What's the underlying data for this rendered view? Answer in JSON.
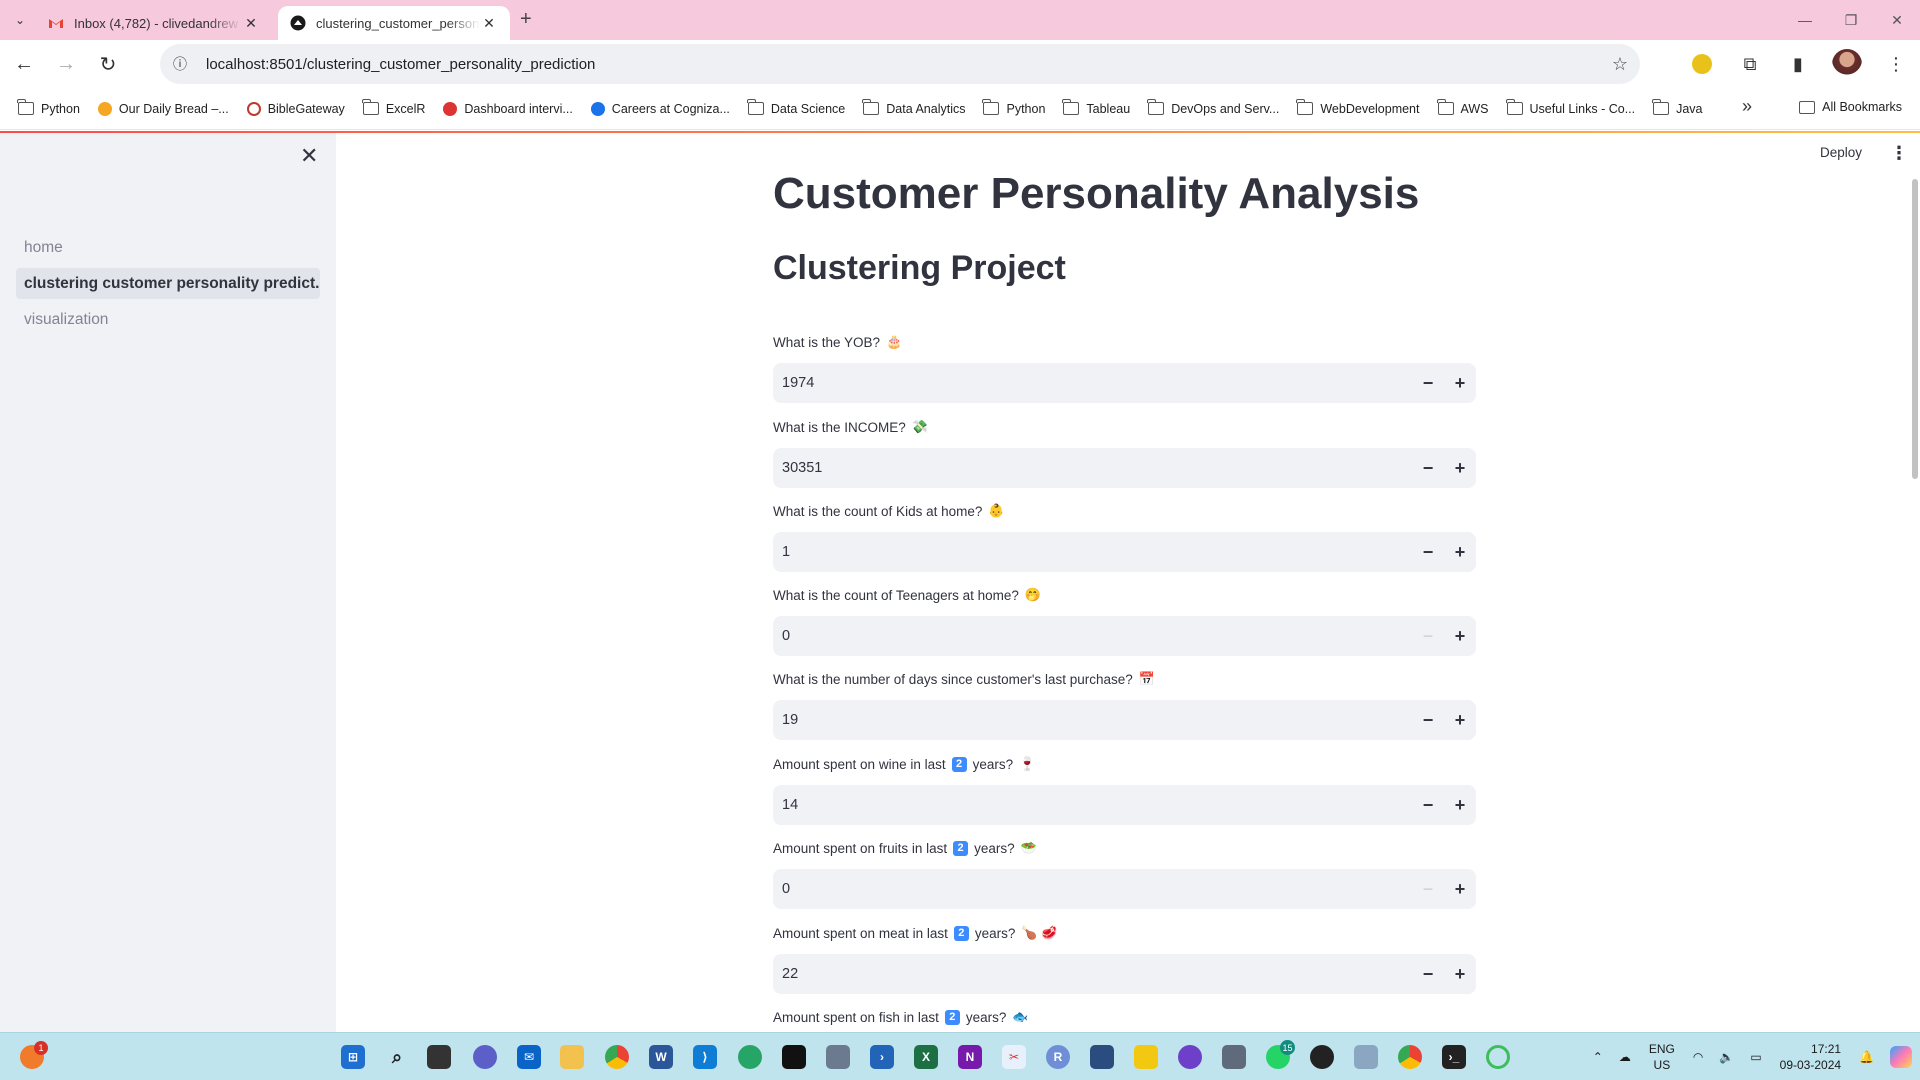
{
  "browser": {
    "tabs": [
      {
        "title": "Inbox (4,782) - clivedandrew",
        "active": false
      },
      {
        "title": "clustering_customer_personality",
        "active": true
      }
    ],
    "url": "localhost:8501/clustering_customer_personality_prediction",
    "bookmarks": [
      {
        "label": "Python",
        "icon": "folder-icon"
      },
      {
        "label": "Our Daily Bread –...",
        "icon": "odb-icon"
      },
      {
        "label": "BibleGateway",
        "icon": "biblegateway-icon"
      },
      {
        "label": "ExcelR",
        "icon": "folder-icon"
      },
      {
        "label": "Dashboard intervi...",
        "icon": "link-icon"
      },
      {
        "label": "Careers at Cogniza...",
        "icon": "cognizant-icon"
      },
      {
        "label": "Data Science",
        "icon": "folder-icon"
      },
      {
        "label": "Data Analytics",
        "icon": "folder-icon"
      },
      {
        "label": "Python",
        "icon": "folder-icon"
      },
      {
        "label": "Tableau",
        "icon": "folder-icon"
      },
      {
        "label": "DevOps and Serv...",
        "icon": "folder-icon"
      },
      {
        "label": "WebDevelopment",
        "icon": "folder-icon"
      },
      {
        "label": "AWS",
        "icon": "folder-icon"
      },
      {
        "label": "Useful Links - Co...",
        "icon": "folder-icon"
      },
      {
        "label": "Java",
        "icon": "folder-icon"
      }
    ],
    "more_bookmarks": "»",
    "all_bookmarks": "All Bookmarks"
  },
  "sidebar": {
    "items": [
      {
        "label": "home",
        "active": false
      },
      {
        "label": "clustering customer personality predict...",
        "active": true
      },
      {
        "label": "visualization",
        "active": false
      }
    ]
  },
  "header": {
    "deploy_label": "Deploy"
  },
  "main": {
    "title": "Customer Personality Analysis",
    "subtitle": "Clustering Project",
    "fields": [
      {
        "label": "What is the YOB?",
        "emoji": "🎂",
        "value": "1974",
        "minus_disabled": false
      },
      {
        "label": "What is the INCOME?",
        "emoji": "💸",
        "value": "30351",
        "minus_disabled": false
      },
      {
        "label": "What is the count of Kids at home?",
        "emoji": "👶",
        "value": "1",
        "minus_disabled": false
      },
      {
        "label": "What is the count of Teenagers at home?",
        "emoji": "🤭",
        "value": "0",
        "minus_disabled": true
      },
      {
        "label": "What is the number of days since customer's last purchase?",
        "emoji": "📅",
        "value": "19",
        "minus_disabled": false
      },
      {
        "label_pre": "Amount spent on wine in last",
        "keycap": "2",
        "label_post": "years?",
        "emoji": "🍷",
        "value": "14",
        "minus_disabled": false
      },
      {
        "label_pre": "Amount spent on fruits in last",
        "keycap": "2",
        "label_post": "years?",
        "emoji": "🥗",
        "value": "0",
        "minus_disabled": true
      },
      {
        "label_pre": "Amount spent on meat in last",
        "keycap": "2",
        "label_post": "years?",
        "emoji": "🍗 🥩",
        "value": "22",
        "minus_disabled": false
      },
      {
        "label_pre": "Amount spent on fish in last",
        "keycap": "2",
        "label_post": "years?",
        "emoji": "🐟"
      }
    ]
  },
  "taskbar": {
    "notification_badge": "1",
    "whatsapp_badge": "15",
    "language": "ENG",
    "region": "US",
    "time": "17:21",
    "date": "09-03-2024"
  },
  "colors": {
    "tabbar_bg": "#f6c9dd",
    "sidebar_bg": "#f0f2f6",
    "input_bg": "#f0f2f6",
    "taskbar_bg": "#bfe4ee",
    "keycap_blue": "#3d8cff"
  }
}
